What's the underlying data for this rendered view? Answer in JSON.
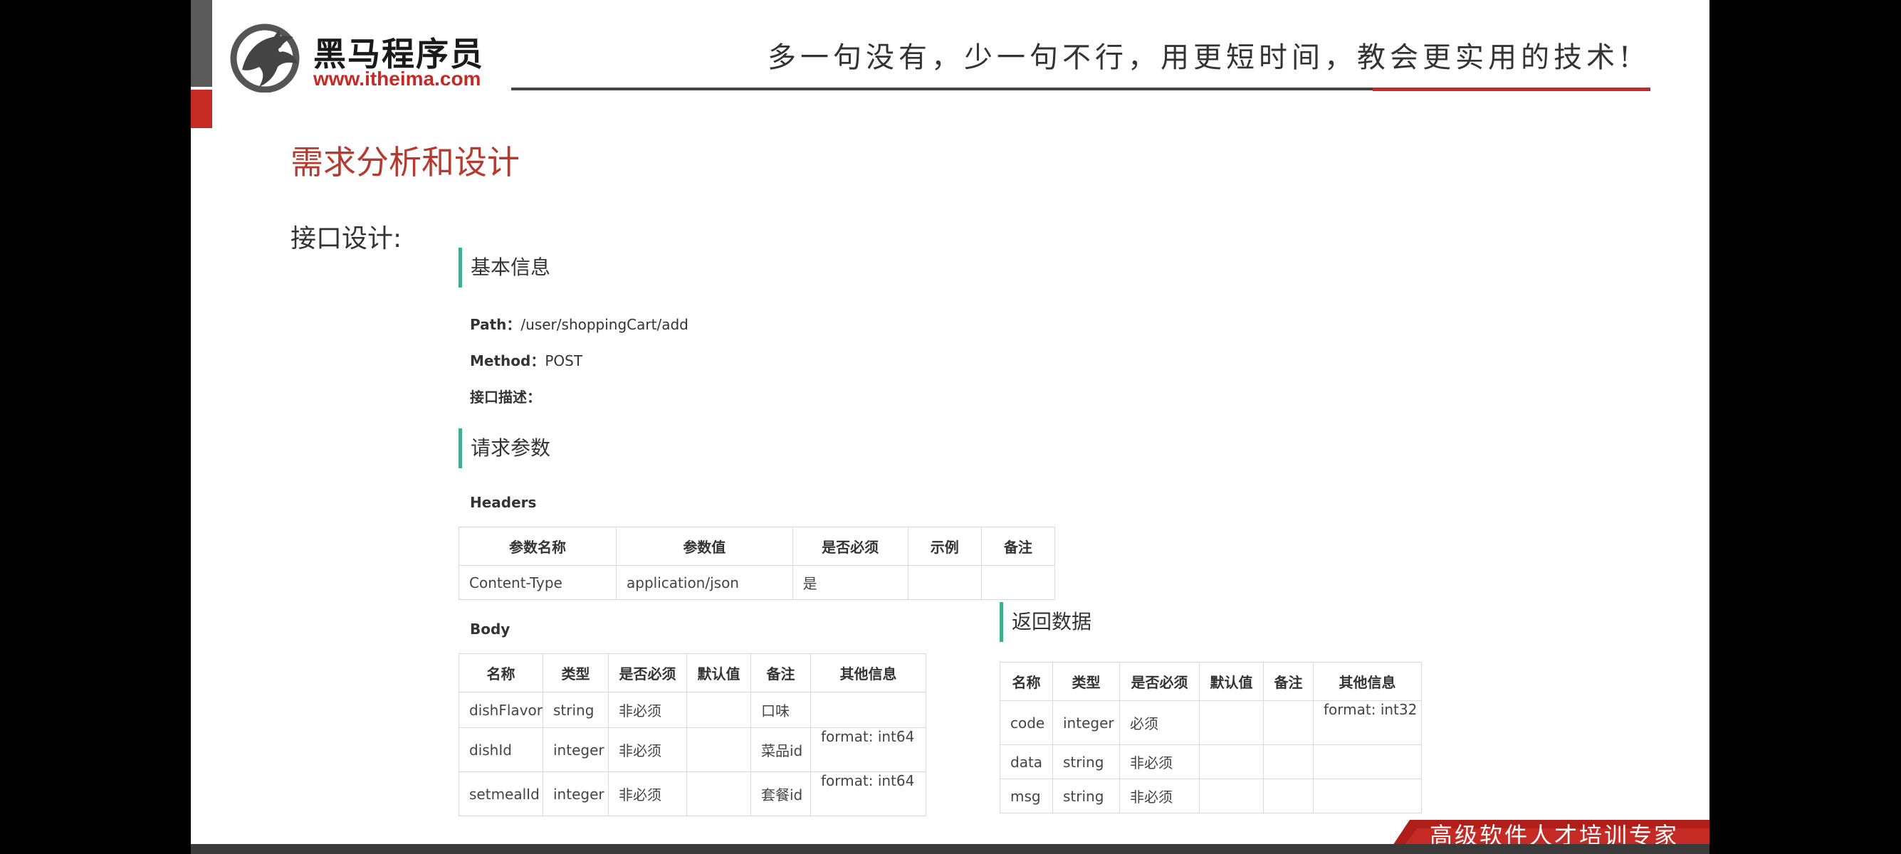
{
  "brand": {
    "name_cn": "黑马程序员",
    "url": "www.itheima.com",
    "slogan": "多一句没有，少一句不行，用更短时间，教会更实用的技术!",
    "footer_tagline": "高级软件人才培训专家",
    "accent": "#c62a24",
    "section_bar": "#3fb08e"
  },
  "page": {
    "title": "需求分析和设计",
    "subtitle": "接口设计:"
  },
  "basic": {
    "heading": "基本信息",
    "path_label": "Path：",
    "path_value": "/user/shoppingCart/add",
    "method_label": "Method：",
    "method_value": "POST",
    "desc_label": "接口描述："
  },
  "request": {
    "heading": "请求参数",
    "headers_label": "Headers",
    "headers_table": {
      "columns": [
        "参数名称",
        "参数值",
        "是否必须",
        "示例",
        "备注"
      ],
      "rows": [
        [
          "Content-Type",
          "application/json",
          "是",
          "",
          ""
        ]
      ]
    },
    "body_label": "Body",
    "body_table": {
      "columns": [
        "名称",
        "类型",
        "是否必须",
        "默认值",
        "备注",
        "其他信息"
      ],
      "rows": [
        [
          "dishFlavor",
          "string",
          "非必须",
          "",
          "口味",
          ""
        ],
        [
          "dishId",
          "integer",
          "非必须",
          "",
          "菜品id",
          "format: int64"
        ],
        [
          "setmealId",
          "integer",
          "非必须",
          "",
          "套餐id",
          "format: int64"
        ]
      ]
    }
  },
  "response": {
    "heading": "返回数据",
    "table": {
      "columns": [
        "名称",
        "类型",
        "是否必须",
        "默认值",
        "备注",
        "其他信息"
      ],
      "rows": [
        [
          "code",
          "integer",
          "必须",
          "",
          "",
          "format: int32"
        ],
        [
          "data",
          "string",
          "非必须",
          "",
          "",
          ""
        ],
        [
          "msg",
          "string",
          "非必须",
          "",
          "",
          ""
        ]
      ]
    }
  }
}
